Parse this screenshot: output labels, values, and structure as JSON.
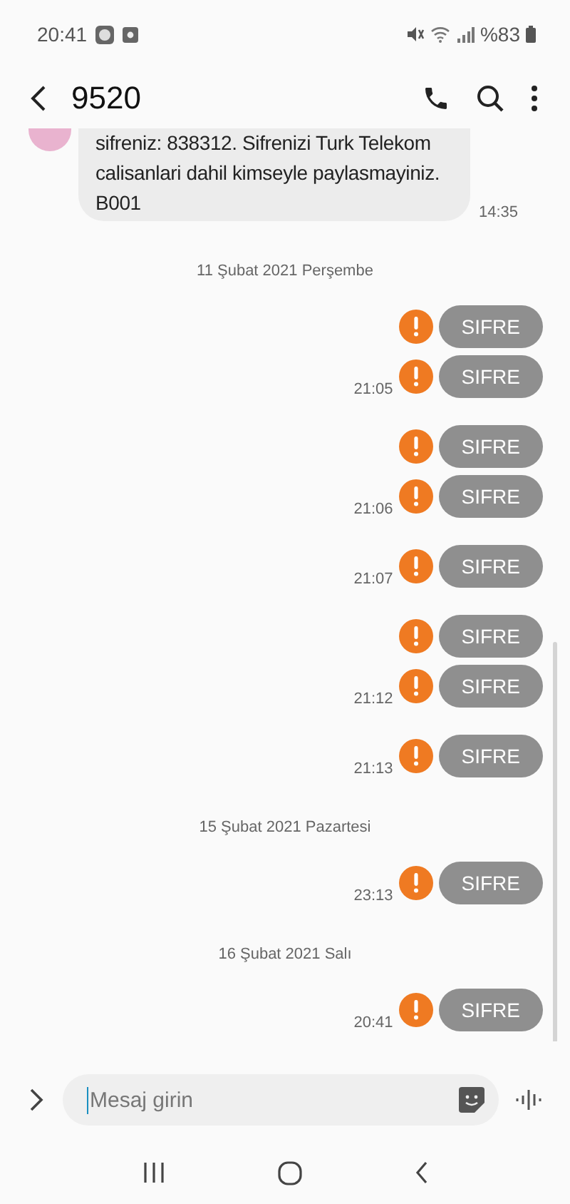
{
  "status_bar": {
    "time": "20:41",
    "battery": "%83"
  },
  "header": {
    "title": "9520"
  },
  "messages": [
    {
      "kind": "incoming",
      "text": "sifreniz: 838312. Sifrenizi Turk Telekom calisanlari dahil kimseyle paylasmayiniz. B001",
      "time": "14:35"
    },
    {
      "kind": "date",
      "text": "11 Şubat 2021 Perşembe"
    },
    {
      "kind": "outgoing",
      "text": "SIFRE",
      "failed": true
    },
    {
      "kind": "outgoing",
      "text": "SIFRE",
      "failed": true,
      "time": "21:05"
    },
    {
      "kind": "outgoing",
      "text": "SIFRE",
      "failed": true
    },
    {
      "kind": "outgoing",
      "text": "SIFRE",
      "failed": true,
      "time": "21:06"
    },
    {
      "kind": "outgoing",
      "text": "SIFRE",
      "failed": true,
      "time": "21:07"
    },
    {
      "kind": "outgoing",
      "text": "SIFRE",
      "failed": true
    },
    {
      "kind": "outgoing",
      "text": "SIFRE",
      "failed": true,
      "time": "21:12"
    },
    {
      "kind": "outgoing",
      "text": "SIFRE",
      "failed": true,
      "time": "21:13"
    },
    {
      "kind": "date",
      "text": "15 Şubat 2021 Pazartesi"
    },
    {
      "kind": "outgoing",
      "text": "SIFRE",
      "failed": true,
      "time": "23:13"
    },
    {
      "kind": "date",
      "text": "16 Şubat 2021 Salı"
    },
    {
      "kind": "outgoing",
      "text": "SIFRE",
      "failed": true,
      "time": "20:41"
    }
  ],
  "compose": {
    "placeholder": "Mesaj girin"
  }
}
